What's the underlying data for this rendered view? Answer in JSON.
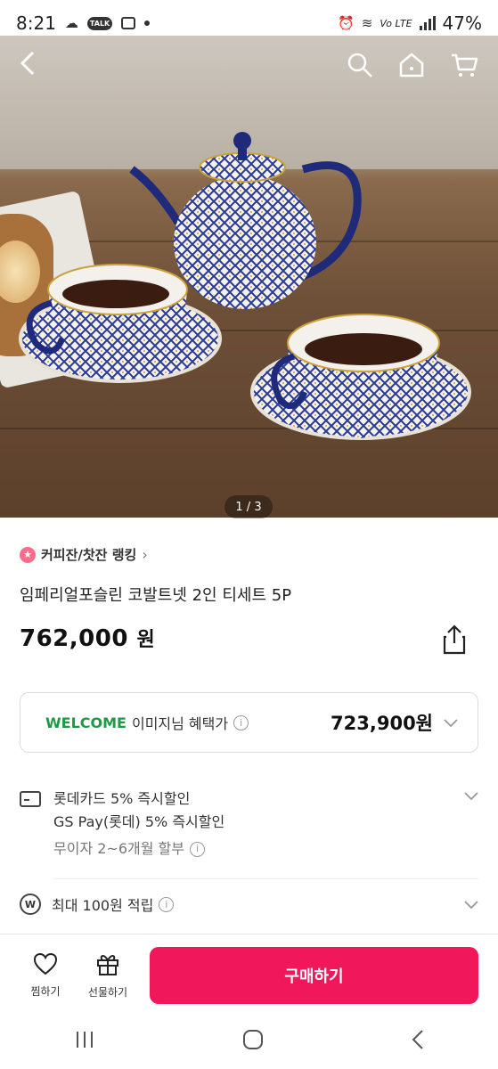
{
  "status_bar": {
    "time": "8:21",
    "talk_badge": "TALK",
    "network": "Vo LTE",
    "battery": "47%"
  },
  "gallery": {
    "counter": "1 / 3"
  },
  "ranking": {
    "label": "커피잔/찻잔 랭킹",
    "chevron": "›"
  },
  "product": {
    "title": "임페리얼포슬린 코발트넷 2인 티세트 5P",
    "price": "762,000",
    "price_unit": "원"
  },
  "welcome": {
    "tag": "WELCOME",
    "text": "이미지님 혜택가",
    "price": "723,900원"
  },
  "benefits": {
    "line1": "롯데카드 5% 즉시할인",
    "line2": "GS Pay(롯데) 5% 즉시할인",
    "line3": "무이자 2~6개월 할부"
  },
  "points": {
    "text": "최대 100원 적립"
  },
  "bottom_bar": {
    "wish_label": "찜하기",
    "gift_label": "선물하기",
    "buy_label": "구매하기"
  },
  "colors": {
    "accent": "#f0185a",
    "welcome_green": "#1d9a42"
  }
}
